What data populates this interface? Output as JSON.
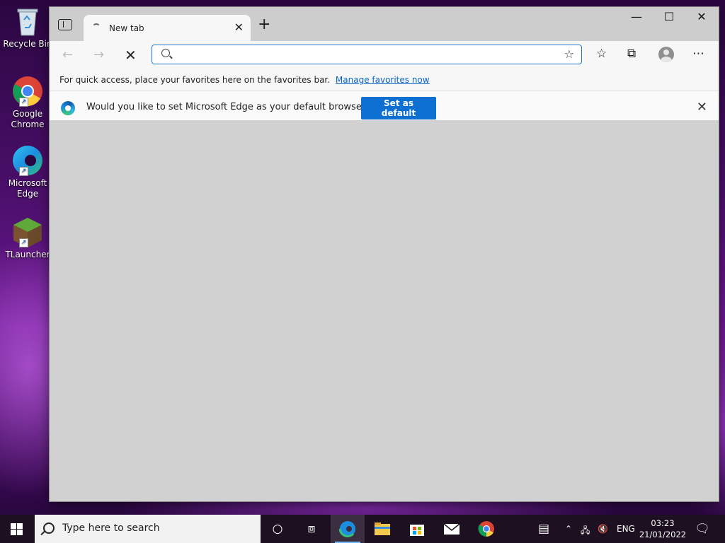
{
  "desktop": {
    "icons": [
      {
        "label": "Recycle Bin"
      },
      {
        "label": "Google Chrome"
      },
      {
        "label": "Microsoft Edge"
      },
      {
        "label": "TLauncher"
      }
    ]
  },
  "browser": {
    "tab_title": "New tab",
    "address_value": "",
    "favorites_bar": {
      "message": "For quick access, place your favorites here on the favorites bar.",
      "link": "Manage favorites now"
    },
    "infobar": {
      "message": "Would you like to set Microsoft Edge as your default browser?",
      "button": "Set as default"
    }
  },
  "taskbar": {
    "search_placeholder": "Type here to search",
    "language": "ENG",
    "time": "03:23",
    "date": "21/01/2022"
  },
  "colors": {
    "accent": "#0c6fd1",
    "link": "#0b63c5"
  }
}
